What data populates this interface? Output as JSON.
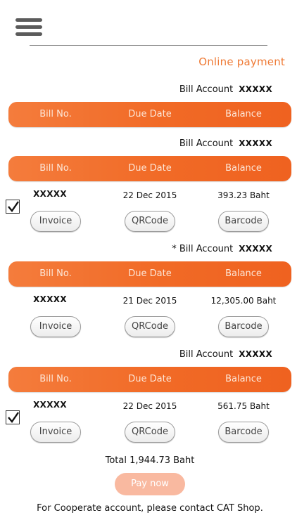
{
  "header": {
    "page_title": "Online payment"
  },
  "table_columns": {
    "bill_no": "Bill No.",
    "due_date": "Due Date",
    "balance": "Balance"
  },
  "sections": [
    {
      "account_label": "Bill Account",
      "account_number": "XXXXX",
      "rows": []
    },
    {
      "account_label": "Bill Account",
      "account_number": "XXXXX",
      "rows": [
        {
          "bill_no": "XXXXX",
          "due_date": "22 Dec 2015",
          "balance": "393.23 Baht",
          "checked": true
        }
      ]
    },
    {
      "account_label": "* Bill Account",
      "account_number": "XXXXX",
      "rows": [
        {
          "bill_no": "XXXXX",
          "due_date": "21 Dec 2015",
          "balance": "12,305.00 Baht",
          "checked": false
        }
      ]
    },
    {
      "account_label": "Bill Account",
      "account_number": "XXXXX",
      "rows": [
        {
          "bill_no": "XXXXX",
          "due_date": "22 Dec 2015",
          "balance": "561.75 Baht",
          "checked": true
        }
      ]
    }
  ],
  "row_actions": {
    "invoice": "Invoice",
    "qrcode": "QRCode",
    "barcode": "Barcode"
  },
  "summary": {
    "total": "Total 1,944.73 Baht",
    "pay_now": "Pay now",
    "note": "For Cooperate account, please contact CAT Shop."
  },
  "colors": {
    "accent": "#ef7a35",
    "header_bar": "#f16a26",
    "pay_button": "#f9b9a0"
  }
}
